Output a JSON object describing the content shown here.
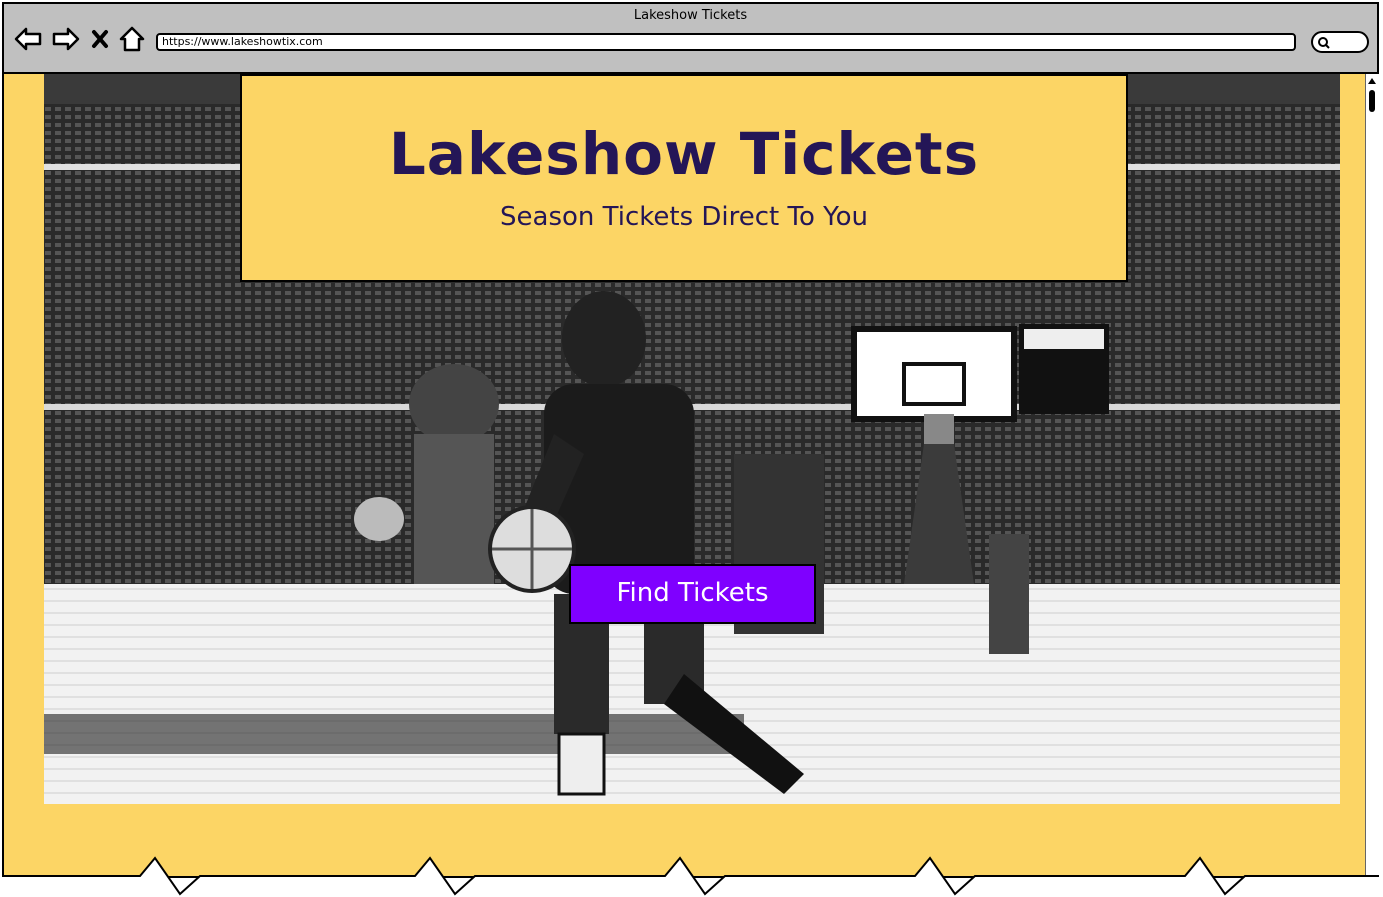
{
  "window": {
    "title": "Lakeshow Tickets"
  },
  "toolbar": {
    "icons": [
      "back-arrow-icon",
      "forward-arrow-icon",
      "close-icon",
      "home-icon"
    ],
    "url": "https://www.lakeshowtix.com",
    "search_icon": "search-icon"
  },
  "hero": {
    "title": "Lakeshow Tickets",
    "subtitle": "Season Tickets Direct To You",
    "cta_label": "Find Tickets"
  },
  "colors": {
    "page_background": "#fcd565",
    "title_text": "#241657",
    "cta_background": "#7f00ff",
    "cta_text": "#ffffff",
    "chrome": "#c0c0c0"
  }
}
